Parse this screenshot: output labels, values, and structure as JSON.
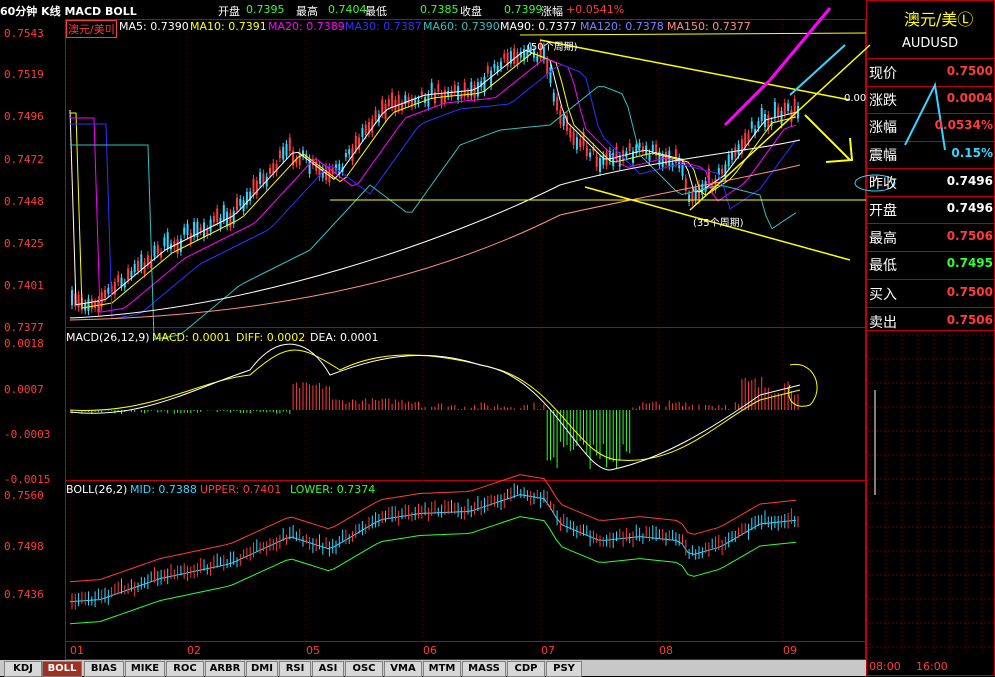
{
  "header": {
    "title": "60分钟 K线 MACD BOLL",
    "open_label": "开盘",
    "open": "0.7395",
    "high_label": "最高",
    "high": "0.7404",
    "low_label": "最低",
    "low": "0.7385",
    "close_label": "收盘",
    "close": "0.7399",
    "change_label": "涨幅",
    "change": "+0.0541%"
  },
  "ma_legend": {
    "symbol": "澳元/美미",
    "ma5": "MA5: 0.7390",
    "ma10": "MA10: 0.7391",
    "ma20": "MA20: 0.7389",
    "ma30": "MA30: 0.7387",
    "ma60": "MA60: 0.7390",
    "ma90": "MA90: 0.7377",
    "ma120": "MA120: 0.7378",
    "ma150": "MA150: 0.7377"
  },
  "macd_legend": {
    "name": "MACD(26,12,9)",
    "macd": "MACD: 0.0001",
    "diff": "DIFF: 0.0002",
    "dea": "DEA: 0.0001"
  },
  "boll_legend": {
    "name": "BOLL(26,2)",
    "mid": "MID: 0.7388",
    "upper": "UPPER: 0.7401",
    "lower": "LOWER: 0.7374"
  },
  "axes": {
    "price": [
      "0.7543",
      "0.7519",
      "0.7496",
      "0.7472",
      "0.7448",
      "0.7425",
      "0.7401",
      "0.7377"
    ],
    "macd": [
      "0.0018",
      "0.0007",
      "-0.0003",
      "-0.0015"
    ],
    "boll": [
      "0.7560",
      "0.7498",
      "0.7436"
    ],
    "dates": [
      "01",
      "02",
      "05",
      "06",
      "07",
      "08",
      "09"
    ]
  },
  "annotations": {
    "period_top": "(50个周期)",
    "period_bottom": "(35个周期)",
    "mark": "0.00"
  },
  "quote": {
    "name": "澳元/美Ⓛ",
    "code": "AUDUSD",
    "rows": [
      {
        "label": "现价",
        "value": "0.7500",
        "color": "#ff3b3b"
      },
      {
        "label": "涨跌",
        "value": "0.0004",
        "color": "#ff3b3b"
      },
      {
        "label": "涨幅",
        "value": "0.0534%",
        "color": "#ff3b3b"
      },
      {
        "label": "震幅",
        "value": "0.15%",
        "color": "#35d7ff"
      },
      {
        "label": "昨收",
        "value": "0.7496",
        "color": "#ffffff"
      },
      {
        "label": "开盘",
        "value": "0.7496",
        "color": "#ffffff"
      },
      {
        "label": "最高",
        "value": "0.7506",
        "color": "#ff3b3b"
      },
      {
        "label": "最低",
        "value": "0.7495",
        "color": "#30ff30"
      },
      {
        "label": "买入",
        "value": "0.7500",
        "color": "#ff3b3b"
      },
      {
        "label": "卖出",
        "value": "0.7506",
        "color": "#ff3b3b"
      }
    ],
    "time_start": "08:00",
    "time_end": "16:00"
  },
  "tabs": [
    "KDJ",
    "BOLL",
    "BIAS",
    "MIKE",
    "ROC",
    "ARBR",
    "DMI",
    "RSI",
    "ASI",
    "OSC",
    "VMA",
    "MTM",
    "MASS",
    "CDP",
    "PSY"
  ],
  "active_tab": "BOLL",
  "colors": {
    "up": "#ff3b3b",
    "down": "#35d7ff",
    "grid": "#8b0000",
    "ma5": "#ffffff",
    "ma10": "#ffff00",
    "ma20": "#ff00ff",
    "ma30": "#3030ff",
    "ma60": "#30c0c0"
  }
}
